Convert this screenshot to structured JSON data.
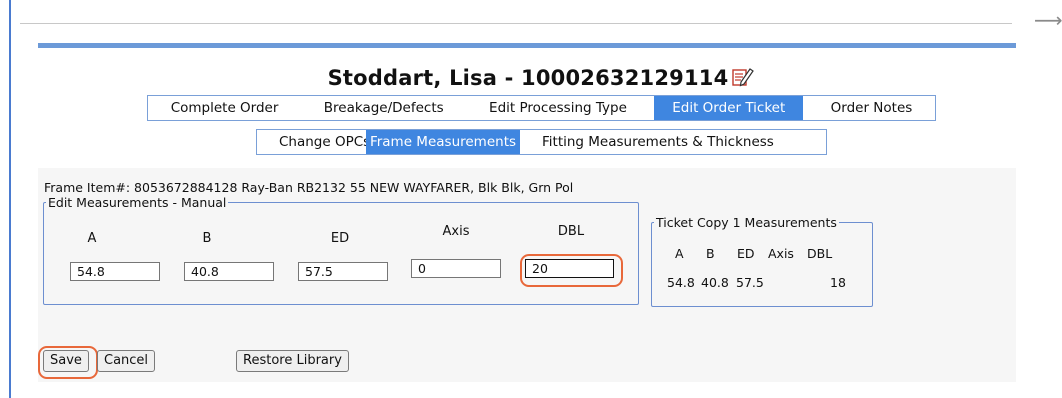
{
  "header": {
    "title": "Stoddart, Lisa - 10002632129114",
    "edit_icon": "edit-pencil-icon",
    "arrow_icon": "arrow-right-icon"
  },
  "tabs_row1": [
    {
      "label": "Complete Order"
    },
    {
      "label": "Breakage/Defects"
    },
    {
      "label": "Edit Processing Type"
    },
    {
      "label": "Edit Order Ticket",
      "active": true
    },
    {
      "label": "Order Notes"
    }
  ],
  "tabs_row2": [
    {
      "label": "Change OPCs"
    },
    {
      "label": "Frame Measurements",
      "active": true
    },
    {
      "label": "Fitting Measurements & Thickness"
    }
  ],
  "frame_item": "Frame Item#: 8053672884128 Ray-Ban RB2132 55 NEW WAYFARER, Blk Blk, Grn Pol",
  "edit_measurements": {
    "legend": "Edit Measurements - Manual",
    "columns": [
      "A",
      "B",
      "ED",
      "Axis",
      "DBL"
    ],
    "values": [
      "54.8",
      "40.8",
      "57.5",
      "0",
      "20"
    ]
  },
  "ticket_copy": {
    "legend": "Ticket Copy 1 Measurements",
    "columns": [
      "A",
      "B",
      "ED",
      "Axis",
      "DBL"
    ],
    "values": [
      "54.8",
      "40.8",
      "57.5",
      "",
      "18"
    ]
  },
  "buttons": {
    "save": "Save",
    "cancel": "Cancel",
    "restore": "Restore Library"
  },
  "colors": {
    "accent": "#3f86e0",
    "focus_ring": "#e8683a",
    "bar": "#6c9ad8"
  }
}
